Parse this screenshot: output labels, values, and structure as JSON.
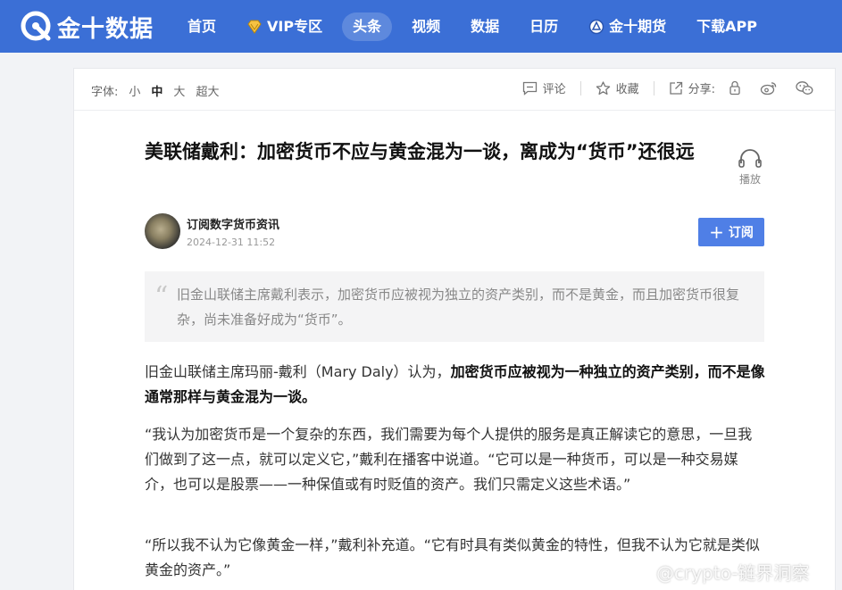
{
  "header": {
    "logo_text": "金十数据",
    "nav": [
      {
        "label": "首页",
        "icon": null,
        "active": false
      },
      {
        "label": "VIP专区",
        "icon": "vip-diamond-icon",
        "active": false
      },
      {
        "label": "头条",
        "icon": null,
        "active": true
      },
      {
        "label": "视频",
        "icon": null,
        "active": false
      },
      {
        "label": "数据",
        "icon": null,
        "active": false
      },
      {
        "label": "日历",
        "icon": null,
        "active": false
      },
      {
        "label": "金十期货",
        "icon": "futures-icon",
        "active": false
      },
      {
        "label": "下载APP",
        "icon": null,
        "active": false
      }
    ],
    "color": "#3b6fd6"
  },
  "toolbar": {
    "font_label": "字体:",
    "font_sizes": [
      "小",
      "中",
      "大",
      "超大"
    ],
    "font_selected": "中",
    "comment_label": "评论",
    "favorite_label": "收藏",
    "share_label": "分享:"
  },
  "article": {
    "title": "美联储戴利：加密货币不应与黄金混为一谈，离成为“货币”还很远",
    "play_label": "播放",
    "author": "订阅数字货币资讯",
    "date": "2024-12-31 11:52",
    "subscribe_label": "订阅",
    "summary": "旧金山联储主席戴利表示，加密货币应被视为独立的资产类别，而不是黄金，而且加密货币很复杂，尚未准备好成为“货币”。",
    "p1_normal": "旧金山联储主席玛丽-戴利（Mary Daly）认为，",
    "p1_bold": "加密货币应被视为一种独立的资产类别，而不是像通常那样与黄金混为一谈。",
    "p2": "“我认为加密货币是一个复杂的东西，我们需要为每个人提供的服务是真正解读它的意思，一旦我们做到了这一点，就可以定义它，”戴利在播客中说道。“它可以是一种货币，可以是一种交易媒介，也可以是股票——一种保值或有时贬值的资产。我们只需定义这些术语。”",
    "p3": "“所以我不认为它像黄金一样，”戴利补充道。“它有时具有类似黄金的特性，但我不认为它就是类似黄金的资产。”"
  },
  "watermark": "@crypto-链界洞察"
}
